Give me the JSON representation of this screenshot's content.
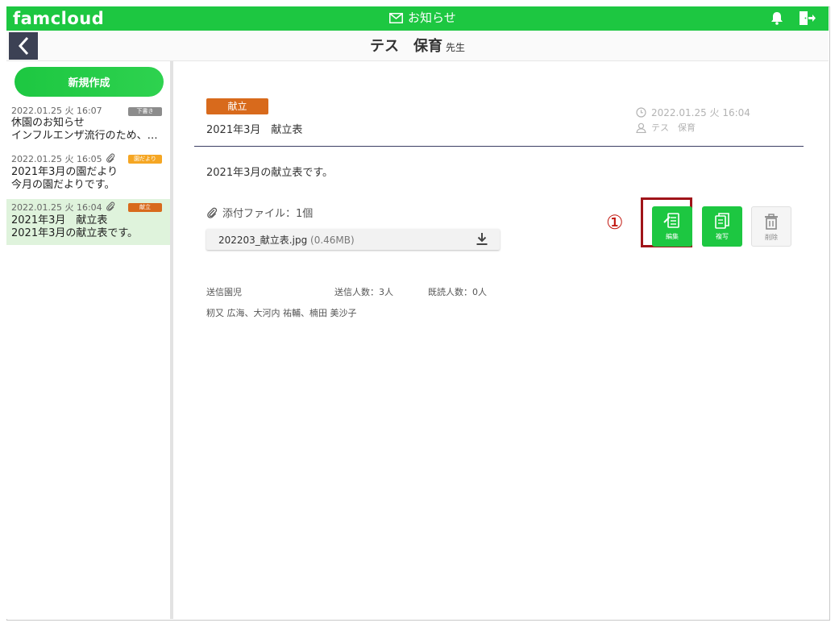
{
  "app": {
    "logo": "famcloud",
    "notice_label": "お知らせ"
  },
  "header": {
    "teacher_name": "テス　保育",
    "teacher_role": "先生"
  },
  "sidebar": {
    "new_button": "新規作成",
    "messages": [
      {
        "datetime": "2022.01.25 火 16:07",
        "has_attachment": false,
        "badge": "下書き",
        "badge_color": "#8c8c8c",
        "line1": "休園のお知らせ",
        "line2": "インフルエンザ流行のため、…",
        "selected": false
      },
      {
        "datetime": "2022.01.25 火 16:05",
        "has_attachment": true,
        "badge": "園だより",
        "badge_color": "#f5a623",
        "line1": "2021年3月の園だより",
        "line2": "今月の園だよりです。",
        "selected": false
      },
      {
        "datetime": "2022.01.25 火 16:04",
        "has_attachment": true,
        "badge": "献立",
        "badge_color": "#d86a1c",
        "line1": "2021年3月　献立表",
        "line2": "2021年3月の献立表です。",
        "selected": true
      }
    ]
  },
  "detail": {
    "category": "献立",
    "subject": "2021年3月　献立表",
    "datetime": "2022.01.25 火 16:04",
    "author": "テス　保育",
    "body": "2021年3月の献立表です。",
    "attachment_label": "添付ファイル：1個",
    "file_name": "202203_献立表.jpg",
    "file_size": "(0.46MB)",
    "recipients_header": "送信園児",
    "sent_count": "送信人数：3人",
    "read_count": "既読人数：0人",
    "recipient_names": "籾又 広海、大河内 祐輔、楠田 美沙子"
  },
  "actions": {
    "edit": "編集",
    "copy": "複写",
    "delete": "削除"
  },
  "annotation": {
    "marker": "①"
  },
  "colors": {
    "brand_green": "#1dc741",
    "menu_tag": "#d86a1c",
    "highlight": "#a01419"
  }
}
